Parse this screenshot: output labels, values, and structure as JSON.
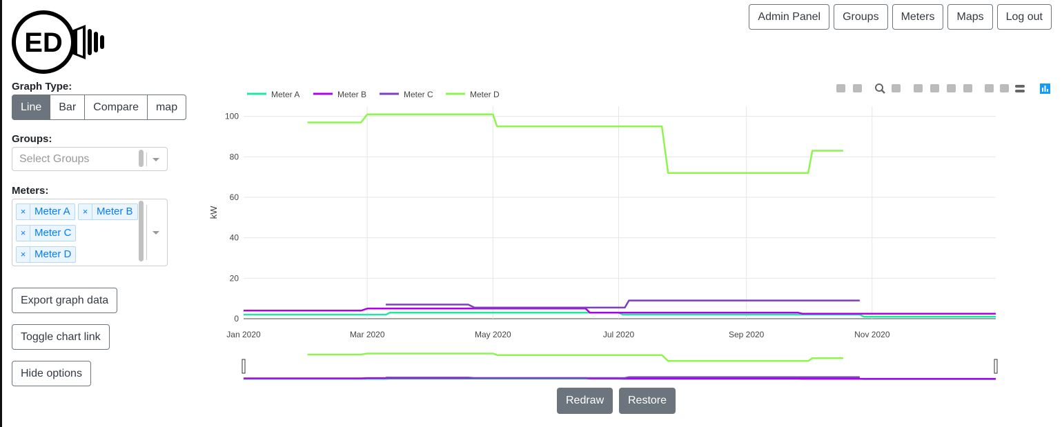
{
  "logo": {
    "text": "ED"
  },
  "nav": {
    "admin": "Admin Panel",
    "groups": "Groups",
    "meters": "Meters",
    "maps": "Maps",
    "logout": "Log out"
  },
  "graph_type": {
    "label": "Graph Type:",
    "options": [
      "Line",
      "Bar",
      "Compare",
      "map"
    ],
    "selected": "Line"
  },
  "groups": {
    "label": "Groups:",
    "placeholder": "Select Groups"
  },
  "meters": {
    "label": "Meters:",
    "selected": [
      "Meter A",
      "Meter B",
      "Meter C",
      "Meter D"
    ],
    "remove_glyph": "×"
  },
  "buttons": {
    "export": "Export graph data",
    "toggle_link": "Toggle chart link",
    "hide_options": "Hide options",
    "redraw": "Redraw",
    "restore": "Restore"
  },
  "chart_data": {
    "type": "line",
    "ylabel": "kW",
    "ylim": [
      0,
      105
    ],
    "yticks": [
      0,
      20,
      40,
      60,
      80,
      100
    ],
    "xlim": [
      "2020-01-01",
      "2020-12-31"
    ],
    "xticks": [
      {
        "date": "2020-01-01",
        "label": "Jan 2020"
      },
      {
        "date": "2020-03-01",
        "label": "Mar 2020"
      },
      {
        "date": "2020-05-01",
        "label": "May 2020"
      },
      {
        "date": "2020-07-01",
        "label": "Jul 2020"
      },
      {
        "date": "2020-09-01",
        "label": "Sep 2020"
      },
      {
        "date": "2020-11-01",
        "label": "Nov 2020"
      }
    ],
    "grid": true,
    "legend": "top-left",
    "rangeslider": true,
    "series": [
      {
        "name": "Meter A",
        "color": "#1de9a4",
        "points": [
          [
            "2020-01-01",
            2
          ],
          [
            "2020-03-10",
            2
          ],
          [
            "2020-03-12",
            3
          ],
          [
            "2020-07-01",
            3
          ],
          [
            "2020-07-03",
            2
          ],
          [
            "2020-10-26",
            2
          ],
          [
            "2020-10-28",
            1
          ],
          [
            "2020-12-31",
            1
          ]
        ]
      },
      {
        "name": "Meter B",
        "color": "#b000e8",
        "points": [
          [
            "2020-01-01",
            4
          ],
          [
            "2020-02-27",
            4
          ],
          [
            "2020-03-01",
            5
          ],
          [
            "2020-06-15",
            5
          ],
          [
            "2020-06-17",
            3
          ],
          [
            "2020-09-26",
            3
          ],
          [
            "2020-09-28",
            2.5
          ],
          [
            "2020-12-31",
            2.5
          ]
        ]
      },
      {
        "name": "Meter C",
        "color": "#7b3fbf",
        "points": [
          [
            "2020-03-10",
            7
          ],
          [
            "2020-04-19",
            7
          ],
          [
            "2020-04-22",
            5.5
          ],
          [
            "2020-07-04",
            5.5
          ],
          [
            "2020-07-06",
            9
          ],
          [
            "2020-10-26",
            9
          ]
        ]
      },
      {
        "name": "Meter D",
        "color": "#8ef54f",
        "points": [
          [
            "2020-02-01",
            97
          ],
          [
            "2020-02-27",
            97
          ],
          [
            "2020-03-01",
            101
          ],
          [
            "2020-05-01",
            101
          ],
          [
            "2020-05-03",
            95
          ],
          [
            "2020-07-22",
            95
          ],
          [
            "2020-07-25",
            72
          ],
          [
            "2020-10-01",
            72
          ],
          [
            "2020-10-03",
            83
          ],
          [
            "2020-10-18",
            83
          ]
        ]
      }
    ]
  }
}
